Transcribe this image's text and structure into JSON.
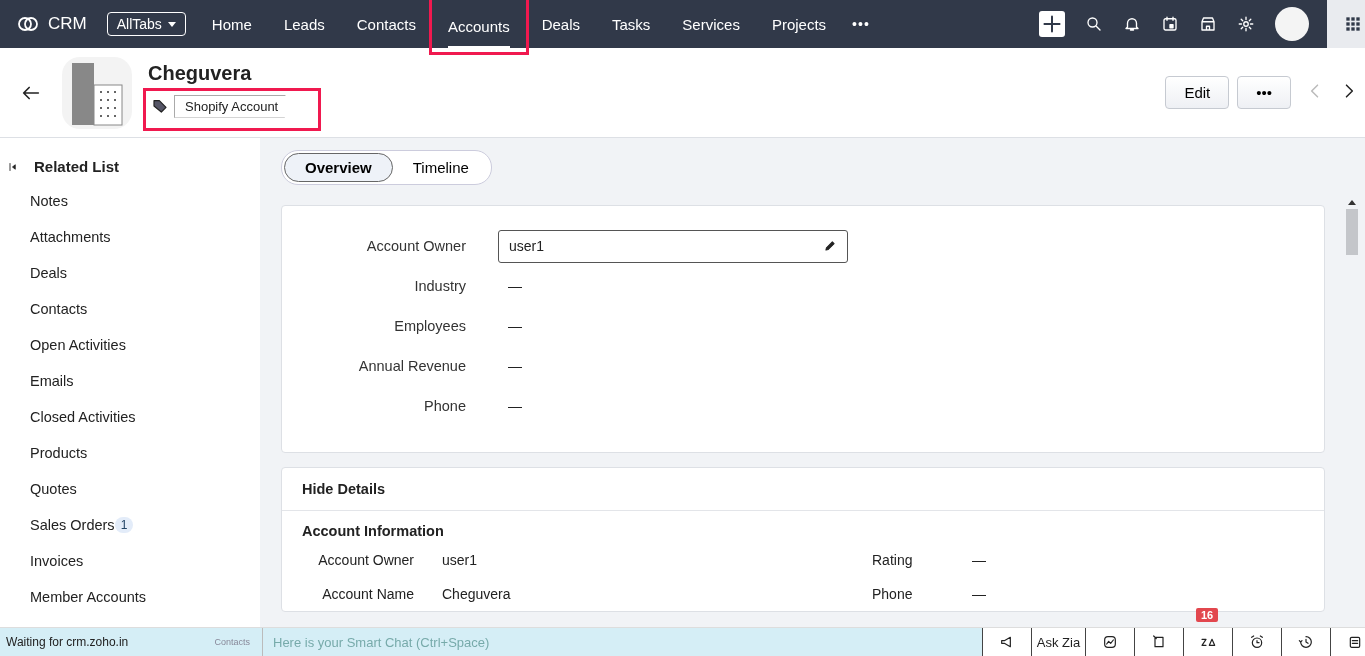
{
  "nav": {
    "logo_text": "CRM",
    "all_tabs": "AllTabs",
    "more": "•••",
    "items": [
      {
        "label": "Home",
        "selected": false,
        "highlighted": false
      },
      {
        "label": "Leads",
        "selected": false,
        "highlighted": false
      },
      {
        "label": "Contacts",
        "selected": false,
        "highlighted": false
      },
      {
        "label": "Accounts",
        "selected": true,
        "highlighted": true
      },
      {
        "label": "Deals",
        "selected": false,
        "highlighted": false
      },
      {
        "label": "Tasks",
        "selected": false,
        "highlighted": false
      },
      {
        "label": "Services",
        "selected": false,
        "highlighted": false
      },
      {
        "label": "Projects",
        "selected": false,
        "highlighted": false
      }
    ]
  },
  "record": {
    "name": "Cheguvera",
    "tag": {
      "label": "Shopify Account",
      "highlighted": true
    },
    "edit": "Edit",
    "more": "•••"
  },
  "related_list": {
    "title": "Related List",
    "items": [
      {
        "label": "Notes"
      },
      {
        "label": "Attachments"
      },
      {
        "label": "Deals"
      },
      {
        "label": "Contacts"
      },
      {
        "label": "Open Activities"
      },
      {
        "label": "Emails"
      },
      {
        "label": "Closed Activities"
      },
      {
        "label": "Products"
      },
      {
        "label": "Quotes"
      },
      {
        "label": "Sales Orders",
        "badge": "1"
      },
      {
        "label": "Invoices"
      },
      {
        "label": "Member Accounts"
      }
    ]
  },
  "view_tabs": [
    {
      "label": "Overview",
      "selected": true
    },
    {
      "label": "Timeline",
      "selected": false
    }
  ],
  "overview": {
    "fields": [
      {
        "label": "Account Owner",
        "value": "user1",
        "kind": "editable"
      },
      {
        "label": "Industry",
        "value": "—",
        "kind": "text"
      },
      {
        "label": "Employees",
        "value": "—",
        "kind": "text"
      },
      {
        "label": "Annual Revenue",
        "value": "—",
        "kind": "text"
      },
      {
        "label": "Phone",
        "value": "—",
        "kind": "text"
      }
    ]
  },
  "details": {
    "toggle": "Hide Details",
    "section": "Account Information",
    "rows": [
      {
        "left_label": "Account Owner",
        "left_value": "user1",
        "right_label": "Rating",
        "right_value": "—"
      },
      {
        "left_label": "Account Name",
        "left_value": "Cheguvera",
        "right_label": "Phone",
        "right_value": "—"
      }
    ]
  },
  "bottom_bar": {
    "status": "Waiting for crm.zoho.in",
    "chat_tab": "Contacts",
    "chat_placeholder": "Here is your Smart Chat (Ctrl+Space)",
    "ask_zia": "Ask Zia",
    "notification_count": "16"
  }
}
